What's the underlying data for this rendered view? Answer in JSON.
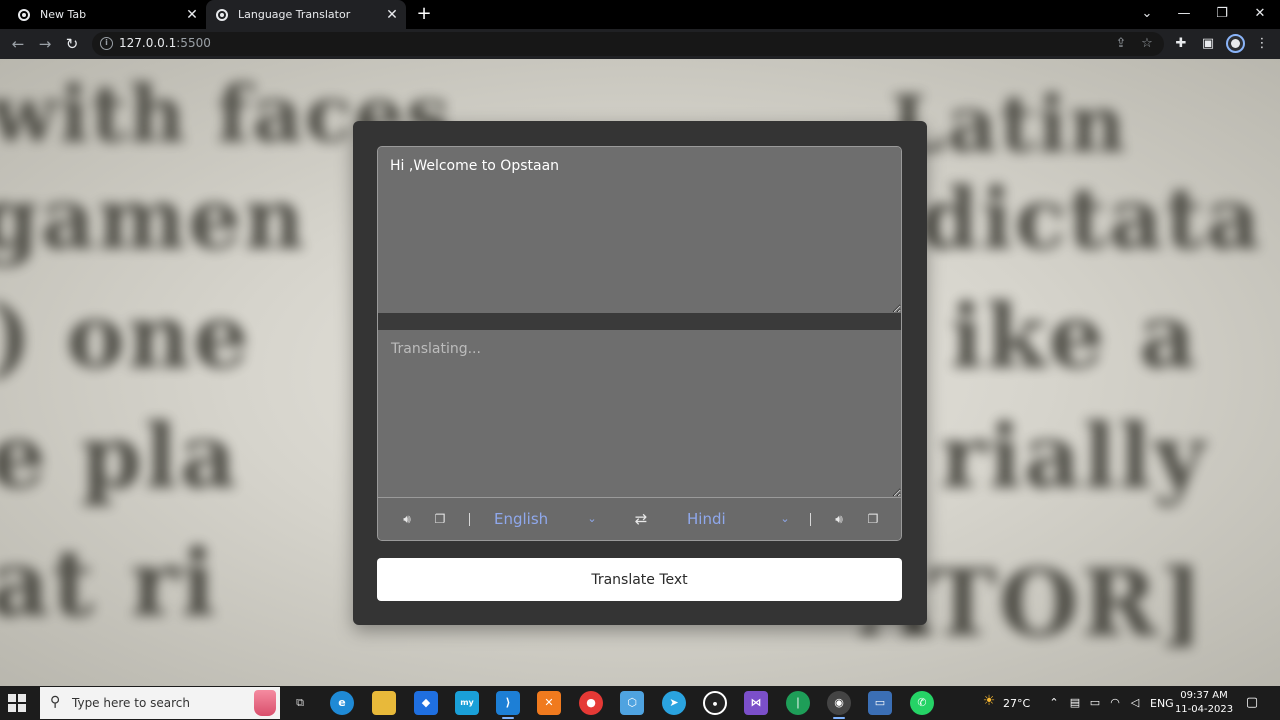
{
  "browser": {
    "tabs": [
      {
        "title": "New Tab"
      },
      {
        "title": "Language Translator"
      }
    ],
    "url_host": "127.0.0.1",
    "url_port": ":5500"
  },
  "translator": {
    "from_text": "Hi ,Welcome to Opstaan",
    "to_placeholder": "Translating...",
    "from_language": "English",
    "to_language": "Hindi",
    "button_label": "Translate Text"
  },
  "background_words": [
    "with faces",
    "Latin",
    "gamen",
    "dictata",
    ") one",
    "ike a",
    "e pla",
    "rially",
    "at ri",
    "ATOR]"
  ],
  "taskbar": {
    "search_placeholder": "Type here to search",
    "weather": "27°C",
    "language": "ENG",
    "time": "09:37 AM",
    "date": "11-04-2023"
  },
  "icons": {
    "speaker": "speaker-icon",
    "copy": "copy-icon",
    "exchange": "exchange-icon",
    "chevron": "chevron-down-icon"
  },
  "colors": {
    "card_bg": "#343434",
    "textarea_bg": "#6e6e6e",
    "language_text": "#8fa8ec",
    "button_bg": "#ffffff"
  }
}
